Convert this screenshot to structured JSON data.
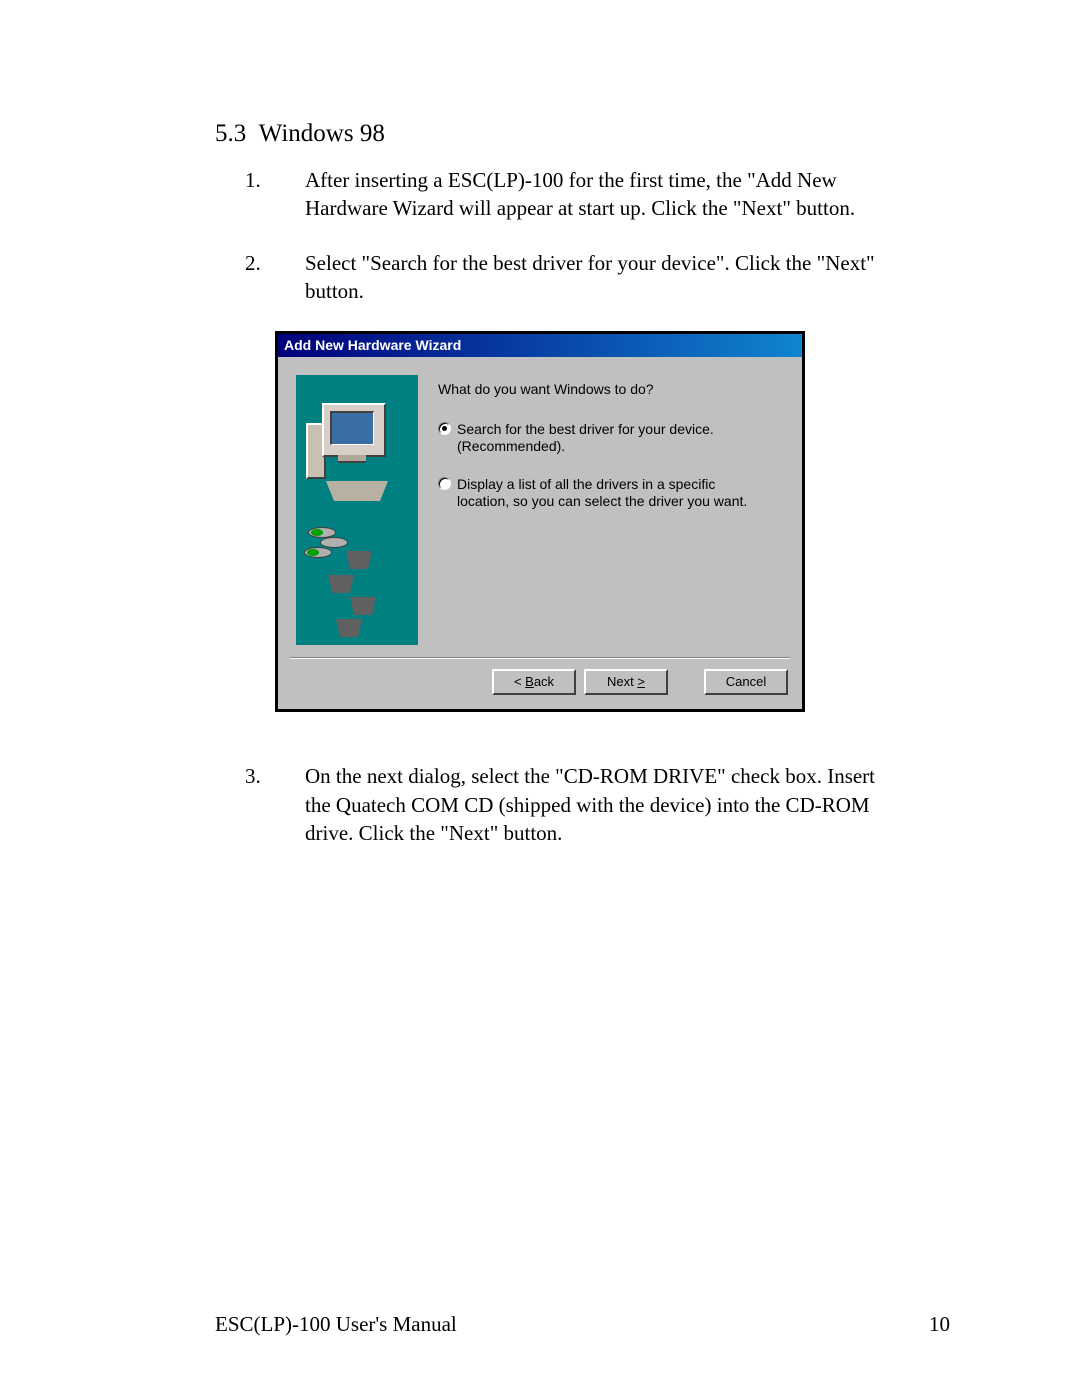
{
  "section": {
    "number": "5.3",
    "title": "Windows 98"
  },
  "steps": [
    {
      "num": "1.",
      "text": "After inserting a ESC(LP)-100 for the first time, the \"Add New Hardware Wizard will appear at start up. Click the \"Next\" button."
    },
    {
      "num": "2.",
      "text": "Select \"Search for the best driver for your device\". Click the \"Next\" button."
    },
    {
      "num": "3.",
      "text": "On the next dialog, select the \"CD-ROM DRIVE\" check box. Insert the Quatech COM CD (shipped with the device) into the CD-ROM drive. Click the \"Next\" button."
    }
  ],
  "dialog": {
    "title": "Add New Hardware Wizard",
    "prompt": "What do you want Windows to do?",
    "options": [
      {
        "label_l1": "Search for the best driver for your device.",
        "label_l2": "(Recommended).",
        "selected": true
      },
      {
        "label_l1": "Display a list of all the drivers in a specific",
        "label_l2": "location, so you can select the driver you want.",
        "selected": false
      }
    ],
    "buttons": {
      "back_prefix": "< ",
      "back_char": "B",
      "back_suffix": "ack",
      "next_prefix": "Next ",
      "next_char": ">",
      "cancel": "Cancel"
    }
  },
  "footer": {
    "left": "ESC(LP)-100 User's Manual",
    "right": "10"
  }
}
